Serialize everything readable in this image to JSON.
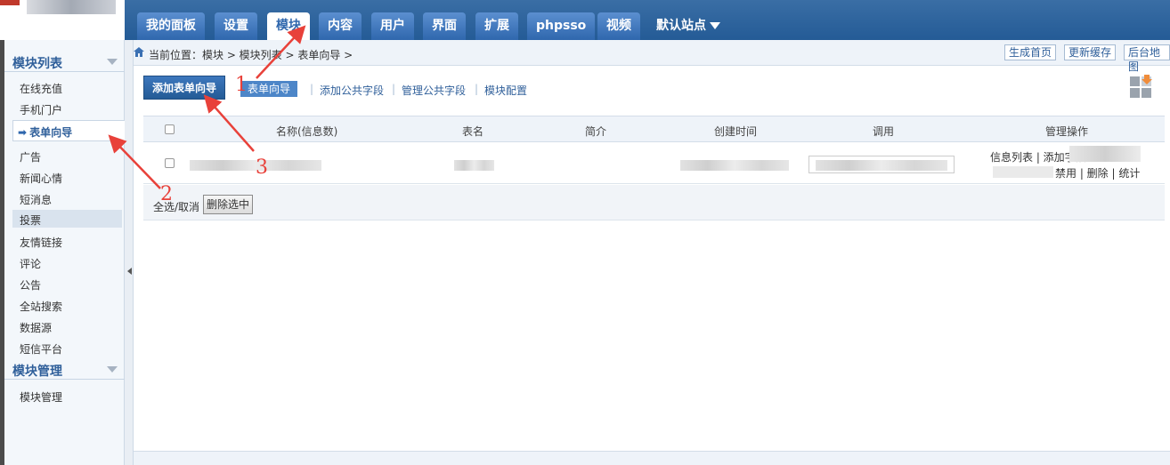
{
  "top_nav": {
    "items": [
      "我的面板",
      "设置",
      "模块",
      "内容",
      "用户",
      "界面",
      "扩展",
      "phpsso",
      "视频"
    ],
    "active_index": 2,
    "site_select": "默认站点"
  },
  "sidebar": {
    "sections": [
      {
        "title": "模块列表",
        "items": [
          "在线充值",
          "手机门户",
          "表单向导",
          "广告",
          "新闻心情",
          "短消息",
          "投票",
          "友情链接",
          "评论",
          "公告",
          "全站搜索",
          "数据源",
          "短信平台"
        ],
        "current_index": 2,
        "hover_index": 6
      },
      {
        "title": "模块管理",
        "items": [
          "模块管理"
        ]
      }
    ]
  },
  "breadcrumb": "当前位置：模块 > 模块列表 > 表单向导 >",
  "quick_buttons": [
    "生成首页",
    "更新缓存",
    "后台地图"
  ],
  "toolbar": {
    "add_button": "添加表单向导",
    "tab": "表单向导",
    "links": [
      "添加公共字段",
      "管理公共字段",
      "模块配置"
    ]
  },
  "table": {
    "columns": [
      "名称(信息数)",
      "表名",
      "简介",
      "创建时间",
      "调用",
      "管理操作"
    ],
    "row_ops": [
      "信息列表 | 添加字段",
      "禁用 | 删除 | 统计"
    ]
  },
  "footer": {
    "select_all": "全选/取消",
    "delete_selected": "删除选中"
  },
  "annotations": [
    "1",
    "2",
    "3"
  ],
  "colors": {
    "nav_blue": "#2f67ad",
    "annotation_red": "#e8413a"
  }
}
